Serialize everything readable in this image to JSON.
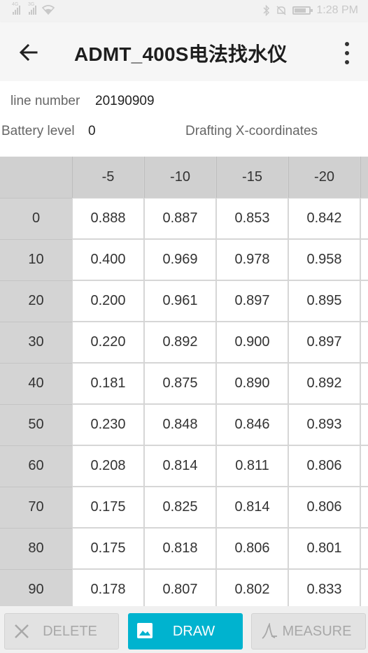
{
  "status_bar": {
    "sim1_tag": "4G",
    "sim2_tag": "3G",
    "time": "1:28 PM",
    "icons": [
      "signal-icon",
      "wifi-icon",
      "bluetooth-icon",
      "mute-icon",
      "battery-icon"
    ]
  },
  "app_bar": {
    "title": "ADMT_400S电法找水仪",
    "back_icon": "arrow-back-icon",
    "menu_icon": "more-vert-icon"
  },
  "info": {
    "line_number_label": "line number",
    "line_number_value": "20190909",
    "battery_label": "Battery level",
    "battery_value": "0",
    "drafting_label": "Drafting X-coordinates"
  },
  "table": {
    "columns": [
      "-5",
      "-10",
      "-15",
      "-20"
    ],
    "rows": [
      {
        "label": "0",
        "values": [
          "0.888",
          "0.887",
          "0.853",
          "0.842"
        ]
      },
      {
        "label": "10",
        "values": [
          "0.400",
          "0.969",
          "0.978",
          "0.958"
        ]
      },
      {
        "label": "20",
        "values": [
          "0.200",
          "0.961",
          "0.897",
          "0.895"
        ]
      },
      {
        "label": "30",
        "values": [
          "0.220",
          "0.892",
          "0.900",
          "0.897"
        ]
      },
      {
        "label": "40",
        "values": [
          "0.181",
          "0.875",
          "0.890",
          "0.892"
        ]
      },
      {
        "label": "50",
        "values": [
          "0.230",
          "0.848",
          "0.846",
          "0.893"
        ]
      },
      {
        "label": "60",
        "values": [
          "0.208",
          "0.814",
          "0.811",
          "0.806"
        ]
      },
      {
        "label": "70",
        "values": [
          "0.175",
          "0.825",
          "0.814",
          "0.806"
        ]
      },
      {
        "label": "80",
        "values": [
          "0.175",
          "0.818",
          "0.806",
          "0.801"
        ]
      },
      {
        "label": "90",
        "values": [
          "0.178",
          "0.807",
          "0.802",
          "0.833"
        ]
      }
    ]
  },
  "bottom_bar": {
    "delete_label": "DELETE",
    "draw_label": "DRAW",
    "measure_label": "MEASURE",
    "draw_color": "#00b3cf"
  }
}
